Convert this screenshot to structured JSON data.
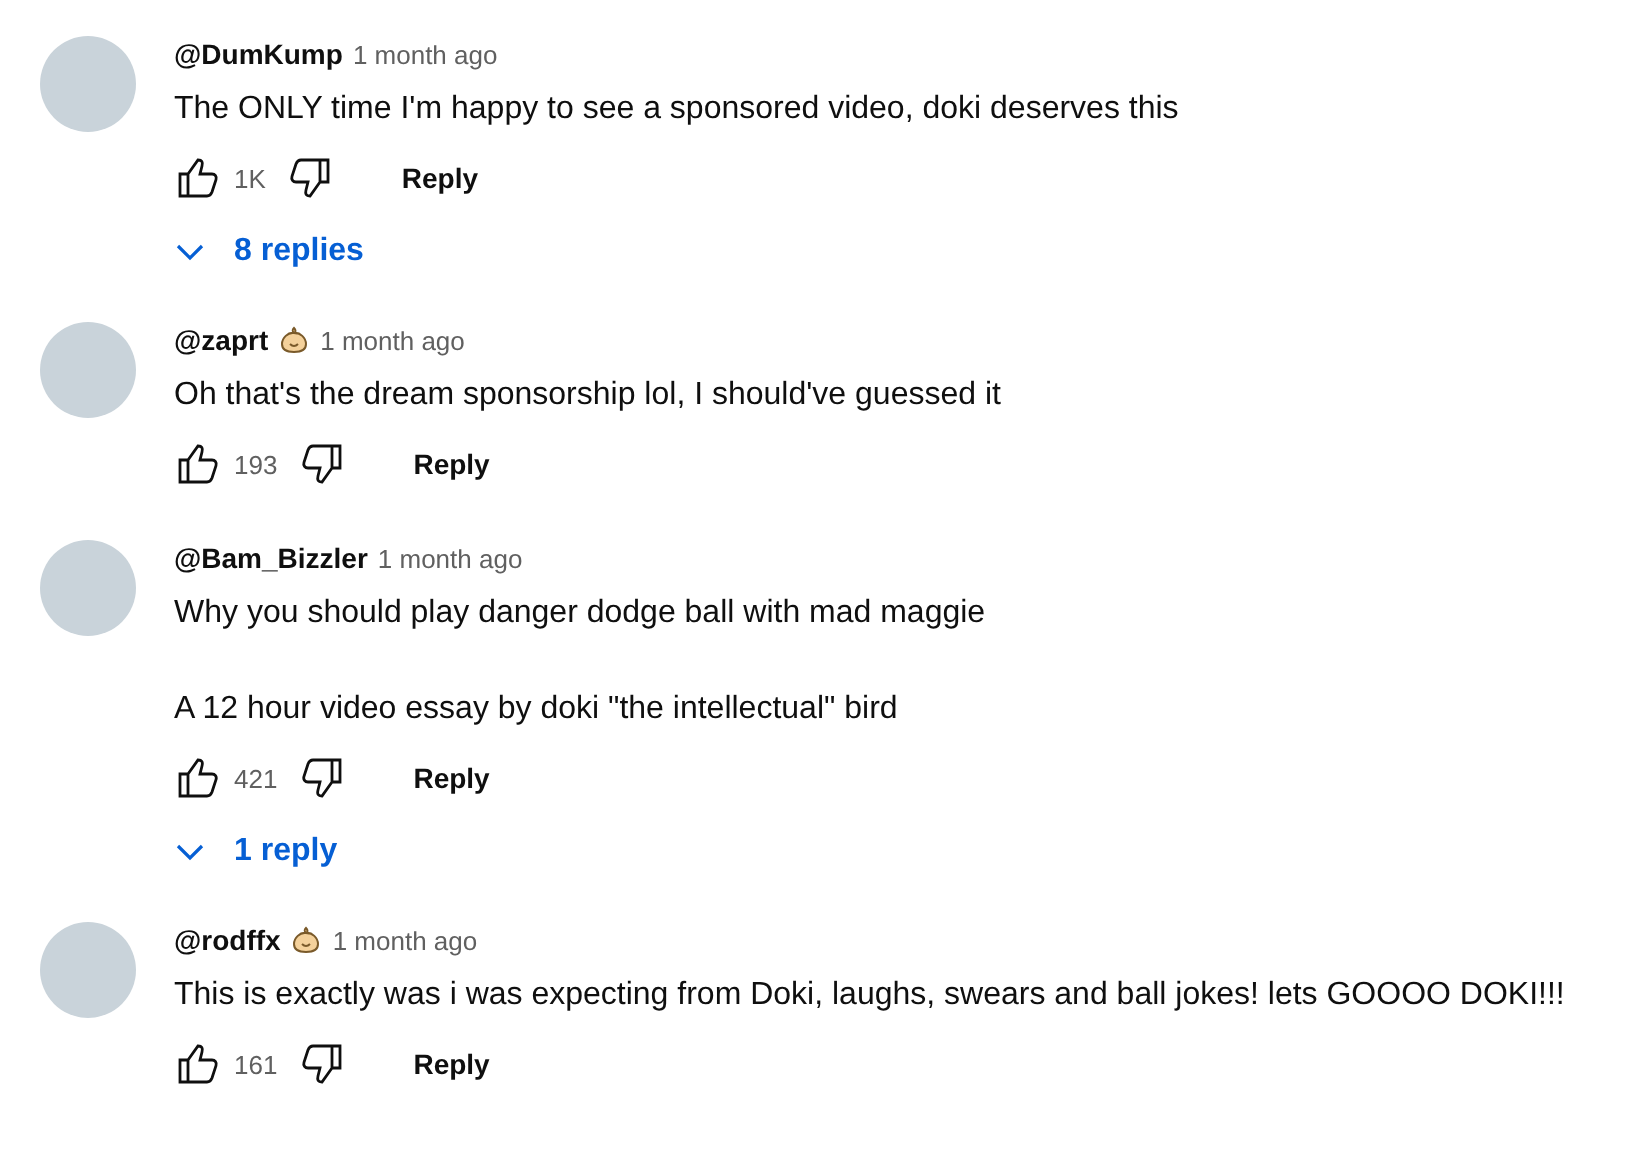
{
  "comments": [
    {
      "author": "@DumKump",
      "member_badge": false,
      "time": "1 month ago",
      "paragraphs": [
        "The ONLY time I'm happy to see a sponsored video, doki deserves this"
      ],
      "likes": "1K",
      "reply_label": "Reply",
      "replies": "8 replies"
    },
    {
      "author": "@zaprt",
      "member_badge": true,
      "time": "1 month ago",
      "paragraphs": [
        "Oh that's the dream sponsorship lol, I should've guessed it"
      ],
      "likes": "193",
      "reply_label": "Reply"
    },
    {
      "author": "@Bam_Bizzler",
      "member_badge": false,
      "time": "1 month ago",
      "paragraphs": [
        "Why you should play danger dodge ball with mad maggie",
        "A 12 hour video essay by doki \"the intellectual\" bird"
      ],
      "likes": "421",
      "reply_label": "Reply",
      "replies": "1 reply"
    },
    {
      "author": "@rodffx",
      "member_badge": true,
      "time": "1 month ago",
      "paragraphs": [
        "This is exactly was i was expecting from Doki, laughs, swears and ball jokes! lets GOOOO DOKI!!!"
      ],
      "likes": "161",
      "reply_label": "Reply"
    }
  ]
}
